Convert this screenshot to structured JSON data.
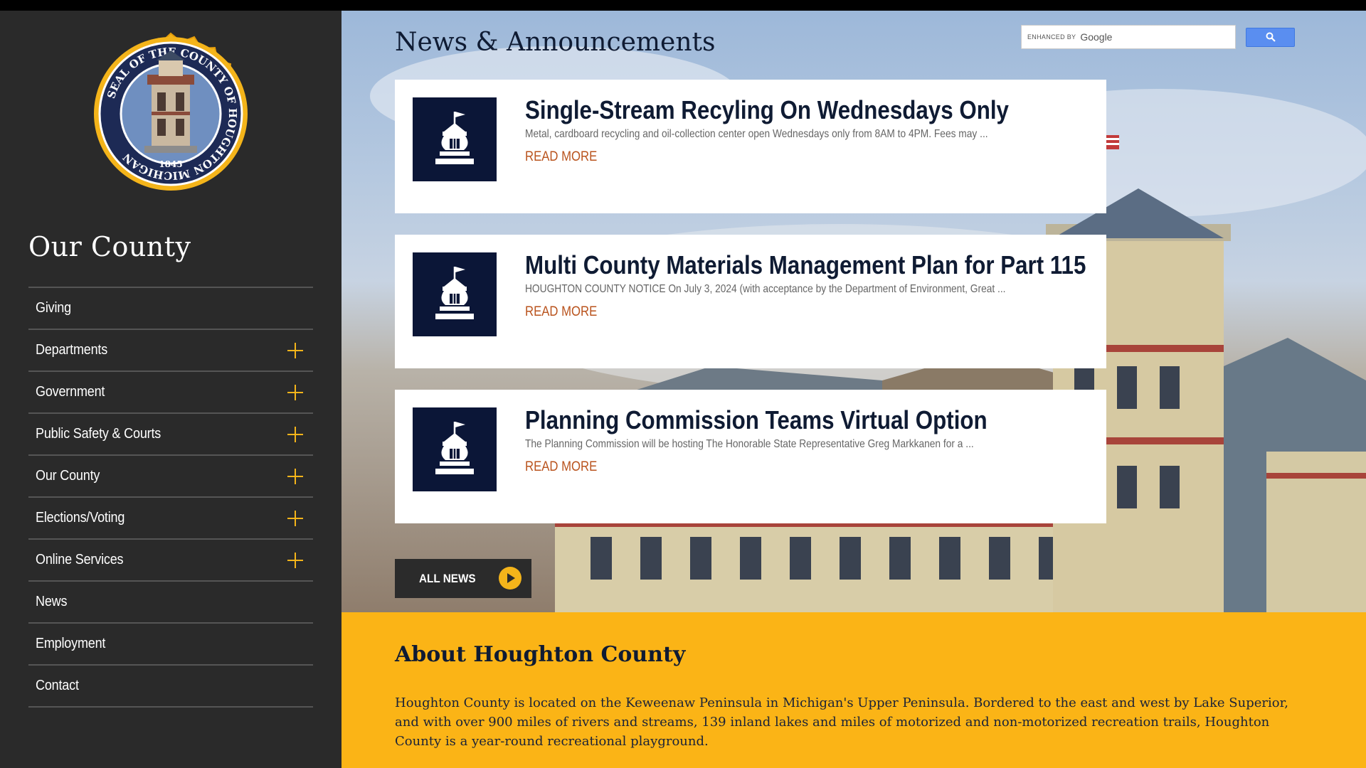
{
  "sidebar": {
    "title": "Our County",
    "seal_text": "SEAL OF THE COUNTY OF HOUGHTON MICHIGAN",
    "seal_year": "1845",
    "items": [
      {
        "label": "Giving",
        "expandable": false
      },
      {
        "label": "Departments",
        "expandable": true
      },
      {
        "label": "Government",
        "expandable": true
      },
      {
        "label": "Public Safety & Courts",
        "expandable": true
      },
      {
        "label": "Our County",
        "expandable": true
      },
      {
        "label": "Elections/Voting",
        "expandable": true
      },
      {
        "label": "Online Services",
        "expandable": true
      },
      {
        "label": "News",
        "expandable": false
      },
      {
        "label": "Employment",
        "expandable": false
      },
      {
        "label": "Contact",
        "expandable": false
      }
    ]
  },
  "search": {
    "enhanced_by": "ENHANCED BY",
    "provider": "Google"
  },
  "news": {
    "heading": "News & Announcements",
    "items": [
      {
        "title": "Single-Stream Recyling On Wednesdays Only",
        "excerpt": "Metal, cardboard recycling and oil-collection center open Wednesdays only from 8AM to 4PM. Fees may ...",
        "more": "READ MORE"
      },
      {
        "title": "Multi County Materials Management Plan for Part 115",
        "excerpt": "HOUGHTON COUNTY NOTICE On July 3, 2024 (with acceptance by the Department of Environment, Great ...",
        "more": "READ MORE"
      },
      {
        "title": "Planning Commission Teams Virtual Option",
        "excerpt": "The Planning Commission will be hosting The Honorable State Representative Greg Markkanen for a ...",
        "more": "READ MORE"
      }
    ],
    "all_news_label": "ALL NEWS"
  },
  "about": {
    "title": "About Houghton County",
    "text": "Houghton County is located on the Keweenaw Peninsula in Michigan's Upper Peninsula. Bordered to the east and west by Lake Superior, and with over 900 miles of rivers and streams, 139 inland lakes and miles of motorized and non-motorized recreation trails, Houghton County is a year-round recreational playground."
  },
  "colors": {
    "accent_gold": "#fbb416",
    "navy": "#0b1637",
    "link_orange": "#b9531d",
    "sidebar_bg": "#2a2a2a"
  }
}
